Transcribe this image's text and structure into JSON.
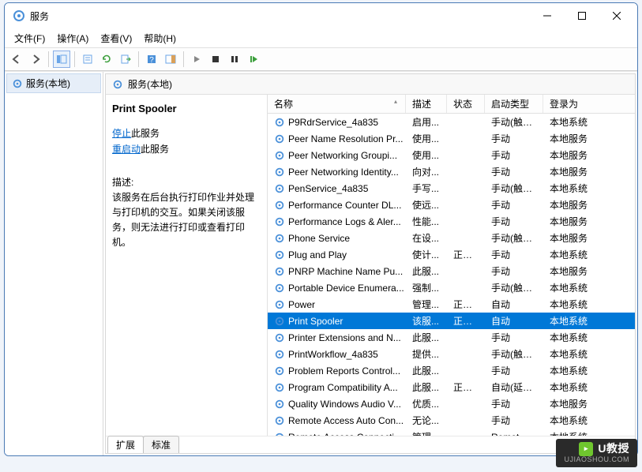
{
  "window": {
    "title": "服务"
  },
  "menu": {
    "file": "文件(F)",
    "action": "操作(A)",
    "view": "查看(V)",
    "help": "帮助(H)"
  },
  "nav": {
    "root": "服务(本地)"
  },
  "content_head": "服务(本地)",
  "detail": {
    "name": "Print Spooler",
    "stop": "停止",
    "stop_suffix": "此服务",
    "restart": "重启动",
    "restart_suffix": "此服务",
    "desc_label": "描述:",
    "desc_text": "该服务在后台执行打印作业并处理与打印机的交互。如果关闭该服务，则无法进行打印或查看打印机。"
  },
  "columns": {
    "name": "名称",
    "desc": "描述",
    "status": "状态",
    "startup": "启动类型",
    "logon": "登录为"
  },
  "rows": [
    {
      "name": "P9RdrService_4a835",
      "desc": "启用...",
      "status": "",
      "startup": "手动(触发...",
      "logon": "本地系统"
    },
    {
      "name": "Peer Name Resolution Pr...",
      "desc": "使用...",
      "status": "",
      "startup": "手动",
      "logon": "本地服务"
    },
    {
      "name": "Peer Networking Groupi...",
      "desc": "使用...",
      "status": "",
      "startup": "手动",
      "logon": "本地服务"
    },
    {
      "name": "Peer Networking Identity...",
      "desc": "向对...",
      "status": "",
      "startup": "手动",
      "logon": "本地服务"
    },
    {
      "name": "PenService_4a835",
      "desc": "手写...",
      "status": "",
      "startup": "手动(触发...",
      "logon": "本地系统"
    },
    {
      "name": "Performance Counter DL...",
      "desc": "使远...",
      "status": "",
      "startup": "手动",
      "logon": "本地服务"
    },
    {
      "name": "Performance Logs & Aler...",
      "desc": "性能...",
      "status": "",
      "startup": "手动",
      "logon": "本地服务"
    },
    {
      "name": "Phone Service",
      "desc": "在设...",
      "status": "",
      "startup": "手动(触发...",
      "logon": "本地服务"
    },
    {
      "name": "Plug and Play",
      "desc": "使计...",
      "status": "正在...",
      "startup": "手动",
      "logon": "本地系统"
    },
    {
      "name": "PNRP Machine Name Pu...",
      "desc": "此服...",
      "status": "",
      "startup": "手动",
      "logon": "本地服务"
    },
    {
      "name": "Portable Device Enumera...",
      "desc": "强制...",
      "status": "",
      "startup": "手动(触发...",
      "logon": "本地系统"
    },
    {
      "name": "Power",
      "desc": "管理...",
      "status": "正在...",
      "startup": "自动",
      "logon": "本地系统"
    },
    {
      "name": "Print Spooler",
      "desc": "该服...",
      "status": "正在...",
      "startup": "自动",
      "logon": "本地系统",
      "selected": true
    },
    {
      "name": "Printer Extensions and N...",
      "desc": "此服...",
      "status": "",
      "startup": "手动",
      "logon": "本地系统"
    },
    {
      "name": "PrintWorkflow_4a835",
      "desc": "提供...",
      "status": "",
      "startup": "手动(触发...",
      "logon": "本地系统"
    },
    {
      "name": "Problem Reports Control...",
      "desc": "此服...",
      "status": "",
      "startup": "手动",
      "logon": "本地系统"
    },
    {
      "name": "Program Compatibility A...",
      "desc": "此服...",
      "status": "正在...",
      "startup": "自动(延迟...",
      "logon": "本地系统"
    },
    {
      "name": "Quality Windows Audio V...",
      "desc": "优质...",
      "status": "",
      "startup": "手动",
      "logon": "本地服务"
    },
    {
      "name": "Remote Access Auto Con...",
      "desc": "无论...",
      "status": "",
      "startup": "手动",
      "logon": "本地系统"
    },
    {
      "name": "Remote Access Connecti...",
      "desc": "管理...",
      "status": "",
      "startup": "Remot...",
      "logon": "本地系统"
    }
  ],
  "tabs": {
    "extended": "扩展",
    "standard": "标准"
  },
  "watermark": {
    "brand": "U教授",
    "url": "UJIAOSHOU.COM"
  }
}
